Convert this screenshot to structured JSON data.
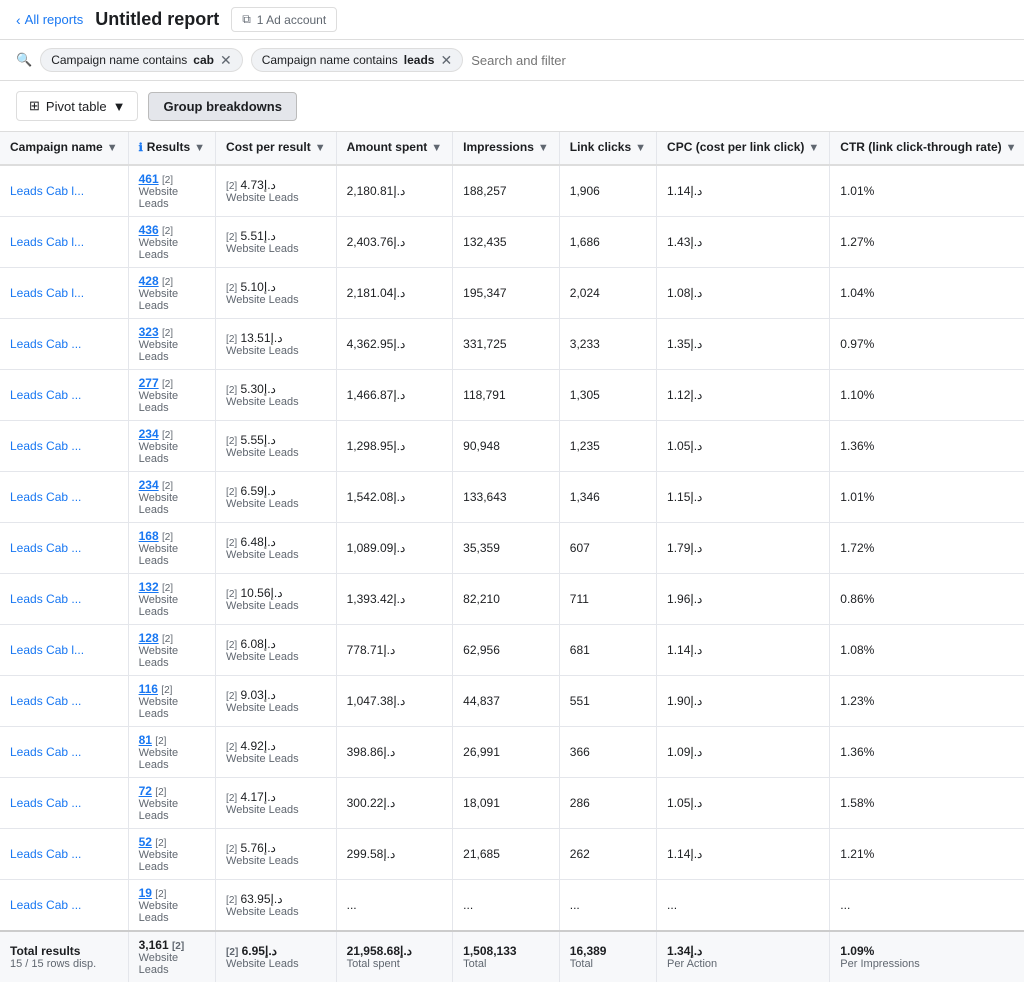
{
  "topBar": {
    "backLabel": "All reports",
    "title": "Untitled report",
    "adAccount": "1 Ad account"
  },
  "filters": [
    {
      "id": "f1",
      "prefix": "Campaign name contains",
      "value": "cab"
    },
    {
      "id": "f2",
      "prefix": "Campaign name contains",
      "value": "leads"
    }
  ],
  "filterPlaceholder": "Search and filter",
  "toolbar": {
    "pivotLabel": "Pivot table",
    "groupBreakdownsLabel": "Group breakdowns"
  },
  "columns": [
    {
      "id": "campaign",
      "label": "Campaign name",
      "sortable": true
    },
    {
      "id": "results",
      "label": "Results",
      "sortable": true,
      "info": true
    },
    {
      "id": "cost",
      "label": "Cost per result",
      "sortable": true
    },
    {
      "id": "amount",
      "label": "Amount spent",
      "sortable": true
    },
    {
      "id": "impressions",
      "label": "Impressions",
      "sortable": true
    },
    {
      "id": "linkclicks",
      "label": "Link clicks",
      "sortable": true
    },
    {
      "id": "cpc",
      "label": "CPC (cost per link click)",
      "sortable": true
    },
    {
      "id": "ctr",
      "label": "CTR (link click-through rate)",
      "sortable": true
    }
  ],
  "rows": [
    {
      "campaign": "Leads Cab l...",
      "results": "461",
      "resultSub": "Website Leads",
      "cost": "د.إ4.73",
      "costSub": "Website Leads",
      "amount": "د.إ2,180.81",
      "impressions": "188,257",
      "linkclicks": "1,906",
      "cpc": "د.إ1.14",
      "ctr": "1.01%"
    },
    {
      "campaign": "Leads Cab l...",
      "results": "436",
      "resultSub": "Website Leads",
      "cost": "د.إ5.51",
      "costSub": "Website Leads",
      "amount": "د.إ2,403.76",
      "impressions": "132,435",
      "linkclicks": "1,686",
      "cpc": "د.إ1.43",
      "ctr": "1.27%"
    },
    {
      "campaign": "Leads Cab l...",
      "results": "428",
      "resultSub": "Website Leads",
      "cost": "د.إ5.10",
      "costSub": "Website Leads",
      "amount": "د.إ2,181.04",
      "impressions": "195,347",
      "linkclicks": "2,024",
      "cpc": "د.إ1.08",
      "ctr": "1.04%"
    },
    {
      "campaign": "Leads Cab ...",
      "results": "323",
      "resultSub": "Website Leads",
      "cost": "د.إ13.51",
      "costSub": "Website Leads",
      "amount": "د.إ4,362.95",
      "impressions": "331,725",
      "linkclicks": "3,233",
      "cpc": "د.إ1.35",
      "ctr": "0.97%"
    },
    {
      "campaign": "Leads Cab ...",
      "results": "277",
      "resultSub": "Website Leads",
      "cost": "د.إ5.30",
      "costSub": "Website Leads",
      "amount": "د.إ1,466.87",
      "impressions": "118,791",
      "linkclicks": "1,305",
      "cpc": "د.إ1.12",
      "ctr": "1.10%"
    },
    {
      "campaign": "Leads Cab ...",
      "results": "234",
      "resultSub": "Website Leads",
      "cost": "د.إ5.55",
      "costSub": "Website Leads",
      "amount": "د.إ1,298.95",
      "impressions": "90,948",
      "linkclicks": "1,235",
      "cpc": "د.إ1.05",
      "ctr": "1.36%"
    },
    {
      "campaign": "Leads Cab ...",
      "results": "234",
      "resultSub": "Website Leads",
      "cost": "د.إ6.59",
      "costSub": "Website Leads",
      "amount": "د.إ1,542.08",
      "impressions": "133,643",
      "linkclicks": "1,346",
      "cpc": "د.إ1.15",
      "ctr": "1.01%"
    },
    {
      "campaign": "Leads Cab ...",
      "results": "168",
      "resultSub": "Website Leads",
      "cost": "د.إ6.48",
      "costSub": "Website Leads",
      "amount": "د.إ1,089.09",
      "impressions": "35,359",
      "linkclicks": "607",
      "cpc": "د.إ1.79",
      "ctr": "1.72%"
    },
    {
      "campaign": "Leads Cab ...",
      "results": "132",
      "resultSub": "Website Leads",
      "cost": "د.إ10.56",
      "costSub": "Website Leads",
      "amount": "د.إ1,393.42",
      "impressions": "82,210",
      "linkclicks": "711",
      "cpc": "د.إ1.96",
      "ctr": "0.86%"
    },
    {
      "campaign": "Leads Cab l...",
      "results": "128",
      "resultSub": "Website Leads",
      "cost": "د.إ6.08",
      "costSub": "Website Leads",
      "amount": "د.إ778.71",
      "impressions": "62,956",
      "linkclicks": "681",
      "cpc": "د.إ1.14",
      "ctr": "1.08%"
    },
    {
      "campaign": "Leads Cab ...",
      "results": "116",
      "resultSub": "Website Leads",
      "cost": "د.إ9.03",
      "costSub": "Website Leads",
      "amount": "د.إ1,047.38",
      "impressions": "44,837",
      "linkclicks": "551",
      "cpc": "د.إ1.90",
      "ctr": "1.23%"
    },
    {
      "campaign": "Leads Cab ...",
      "results": "81",
      "resultSub": "Website Leads",
      "cost": "د.إ4.92",
      "costSub": "Website Leads",
      "amount": "د.إ398.86",
      "impressions": "26,991",
      "linkclicks": "366",
      "cpc": "د.إ1.09",
      "ctr": "1.36%"
    },
    {
      "campaign": "Leads Cab ...",
      "results": "72",
      "resultSub": "Website Leads",
      "cost": "د.إ4.17",
      "costSub": "Website Leads",
      "amount": "د.إ300.22",
      "impressions": "18,091",
      "linkclicks": "286",
      "cpc": "د.إ1.05",
      "ctr": "1.58%"
    },
    {
      "campaign": "Leads Cab ...",
      "results": "52",
      "resultSub": "Website Leads",
      "cost": "د.إ5.76",
      "costSub": "Website Leads",
      "amount": "د.إ299.58",
      "impressions": "21,685",
      "linkclicks": "262",
      "cpc": "د.إ1.14",
      "ctr": "1.21%"
    },
    {
      "campaign": "Leads Cab ...",
      "results": "19",
      "resultSub": "Website Leads",
      "cost": "د.إ63.95",
      "costSub": "Website Leads",
      "amount": "...",
      "impressions": "...",
      "linkclicks": "...",
      "cpc": "...",
      "ctr": "..."
    }
  ],
  "totals": {
    "label": "Total results",
    "sub": "15 / 15 rows disp.",
    "results": "3,161",
    "resultSub": "Website Leads",
    "cost": "د.إ6.95",
    "costSub": "Website Leads",
    "amount": "د.إ21,958.68",
    "amountSub": "Total spent",
    "impressions": "1,508,133",
    "impressionsSub": "Total",
    "linkclicks": "16,389",
    "linkclicksSub": "Total",
    "cpc": "د.إ1.34",
    "cpcSub": "Per Action",
    "ctr": "1.09%",
    "ctrSub": "Per Impressions"
  }
}
